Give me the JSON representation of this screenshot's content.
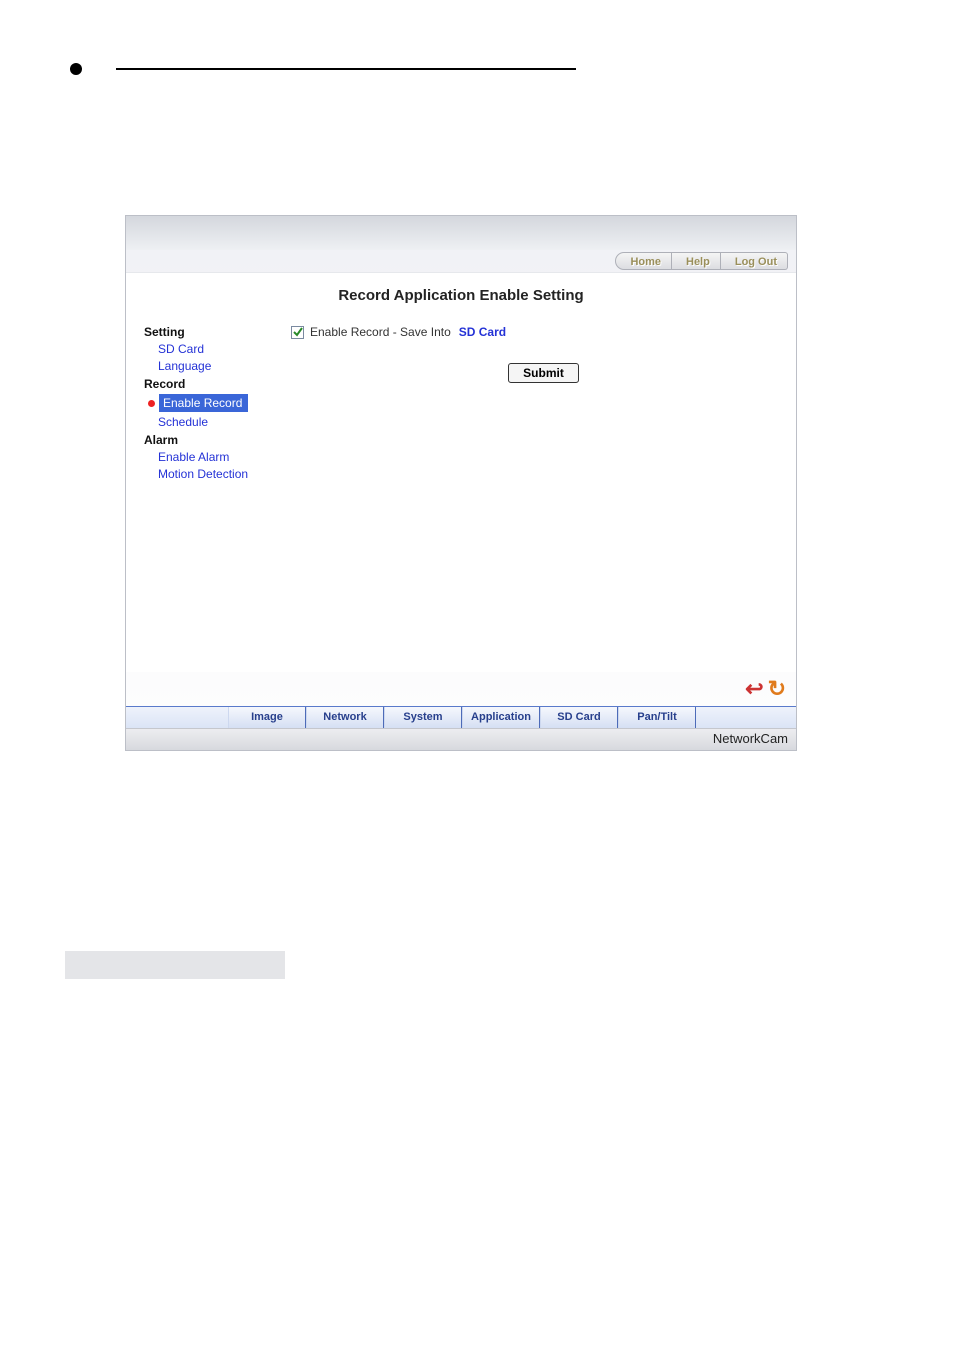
{
  "top_nav": {
    "home": "Home",
    "help": "Help",
    "logout": "Log Out"
  },
  "page_title": "Record Application Enable Setting",
  "sidebar": {
    "groups": [
      {
        "title": "Setting",
        "items": [
          "SD Card",
          "Language"
        ]
      },
      {
        "title": "Record",
        "items": [
          "Enable Record",
          "Schedule"
        ],
        "active_index": 0
      },
      {
        "title": "Alarm",
        "items": [
          "Enable Alarm",
          "Motion Detection"
        ]
      }
    ]
  },
  "main": {
    "checkbox_label": "Enable Record - Save Into",
    "checkbox_link": "SD Card",
    "checkbox_checked": true,
    "submit_label": "Submit"
  },
  "bottom_tabs": [
    "Image",
    "Network",
    "System",
    "Application",
    "SD Card",
    "Pan/Tilt"
  ],
  "footer_brand": "NetworkCam"
}
